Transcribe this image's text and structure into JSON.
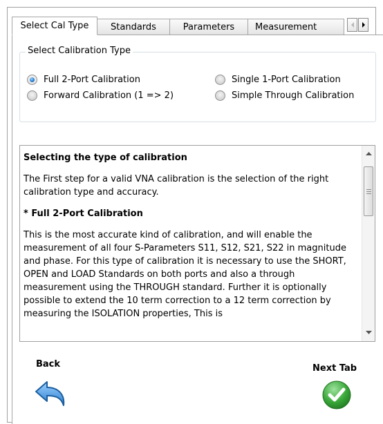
{
  "tabs": [
    {
      "label": "Select Cal Type",
      "active": true
    },
    {
      "label": "Standards",
      "active": false
    },
    {
      "label": "Parameters",
      "active": false
    },
    {
      "label": "Measurement",
      "active": false
    }
  ],
  "tab_scroll": {
    "left_icon": "triangle-left-icon",
    "right_icon": "triangle-right-icon"
  },
  "group": {
    "title": "Select Calibration Type",
    "options": [
      {
        "label": "Full 2-Port Calibration",
        "checked": true
      },
      {
        "label": "Single 1-Port Calibration",
        "checked": false
      },
      {
        "label": "Forward Calibration (1 => 2)",
        "checked": false
      },
      {
        "label": "Simple Through Calibration",
        "checked": false
      }
    ]
  },
  "help": {
    "heading": "Selecting the type of calibration",
    "intro": "The First step for a valid VNA calibration is the selection of the right calibration type and accuracy.",
    "section_heading": "* Full 2-Port Calibration",
    "section_body": "This is the most accurate kind of calibration, and will enable the measurement of all four S-Parameters S11, S12, S21, S22 in magnitude and phase. For this type of calibration it is necessary to use the SHORT, OPEN and LOAD Standards on both ports and also a through measurement using the THROUGH standard. Further it is optionally possible to extend the 10 term correction to a 12 term correction by measuring the ISOLATION properties, This is"
  },
  "nav": {
    "back_label": "Back",
    "next_label": "Next Tab",
    "back_icon": "back-arrow-icon",
    "next_icon": "checkmark-icon"
  },
  "colors": {
    "accent_blue": "#2a7fd0",
    "check_green": "#3aa83a"
  }
}
